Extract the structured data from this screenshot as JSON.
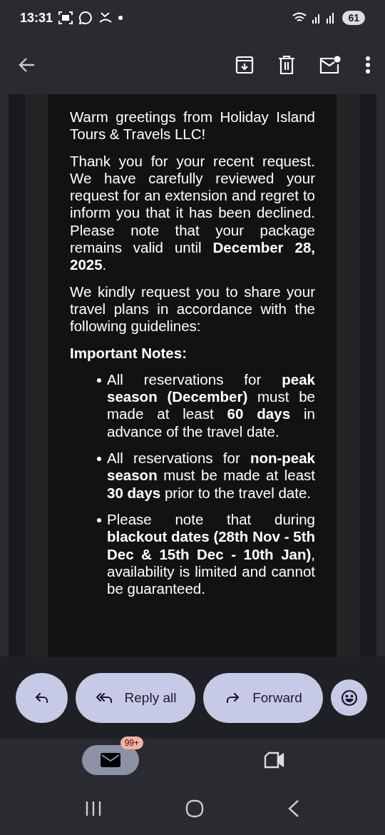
{
  "status_bar": {
    "time": "13:31",
    "battery": "61"
  },
  "email": {
    "paragraphs": [
      "Warm greetings from Holiday Island Tours & Travels LLC!",
      "Thank you for your recent request. We have carefully reviewed your request for an extension and regret to inform you that it has been declined. Please note that your package remains valid until **December 28, 2025**.",
      "We kindly request you to share your travel plans in accordance with the following guidelines:"
    ],
    "notes_heading": "Important Notes:",
    "notes": [
      "All reservations for **peak season (December)** must be made at least **60 days** in advance of the travel date.",
      "All reservations for **non-peak season** must be made at least **30 days** prior to the travel date.",
      "Please note that during **blackout dates (28th Nov - 5th Dec & 15th Dec - 10th Jan)**, availability is limited and cannot be guaranteed."
    ]
  },
  "actions": [
    {
      "kind": "reply"
    },
    {
      "kind": "reply_all",
      "label": "Reply all"
    },
    {
      "kind": "forward",
      "label": "Forward"
    },
    {
      "kind": "emoji"
    }
  ],
  "bottom_nav": [
    {
      "kind": "mail",
      "badge": "99+",
      "selected": true
    },
    {
      "kind": "meet",
      "selected": false
    }
  ]
}
